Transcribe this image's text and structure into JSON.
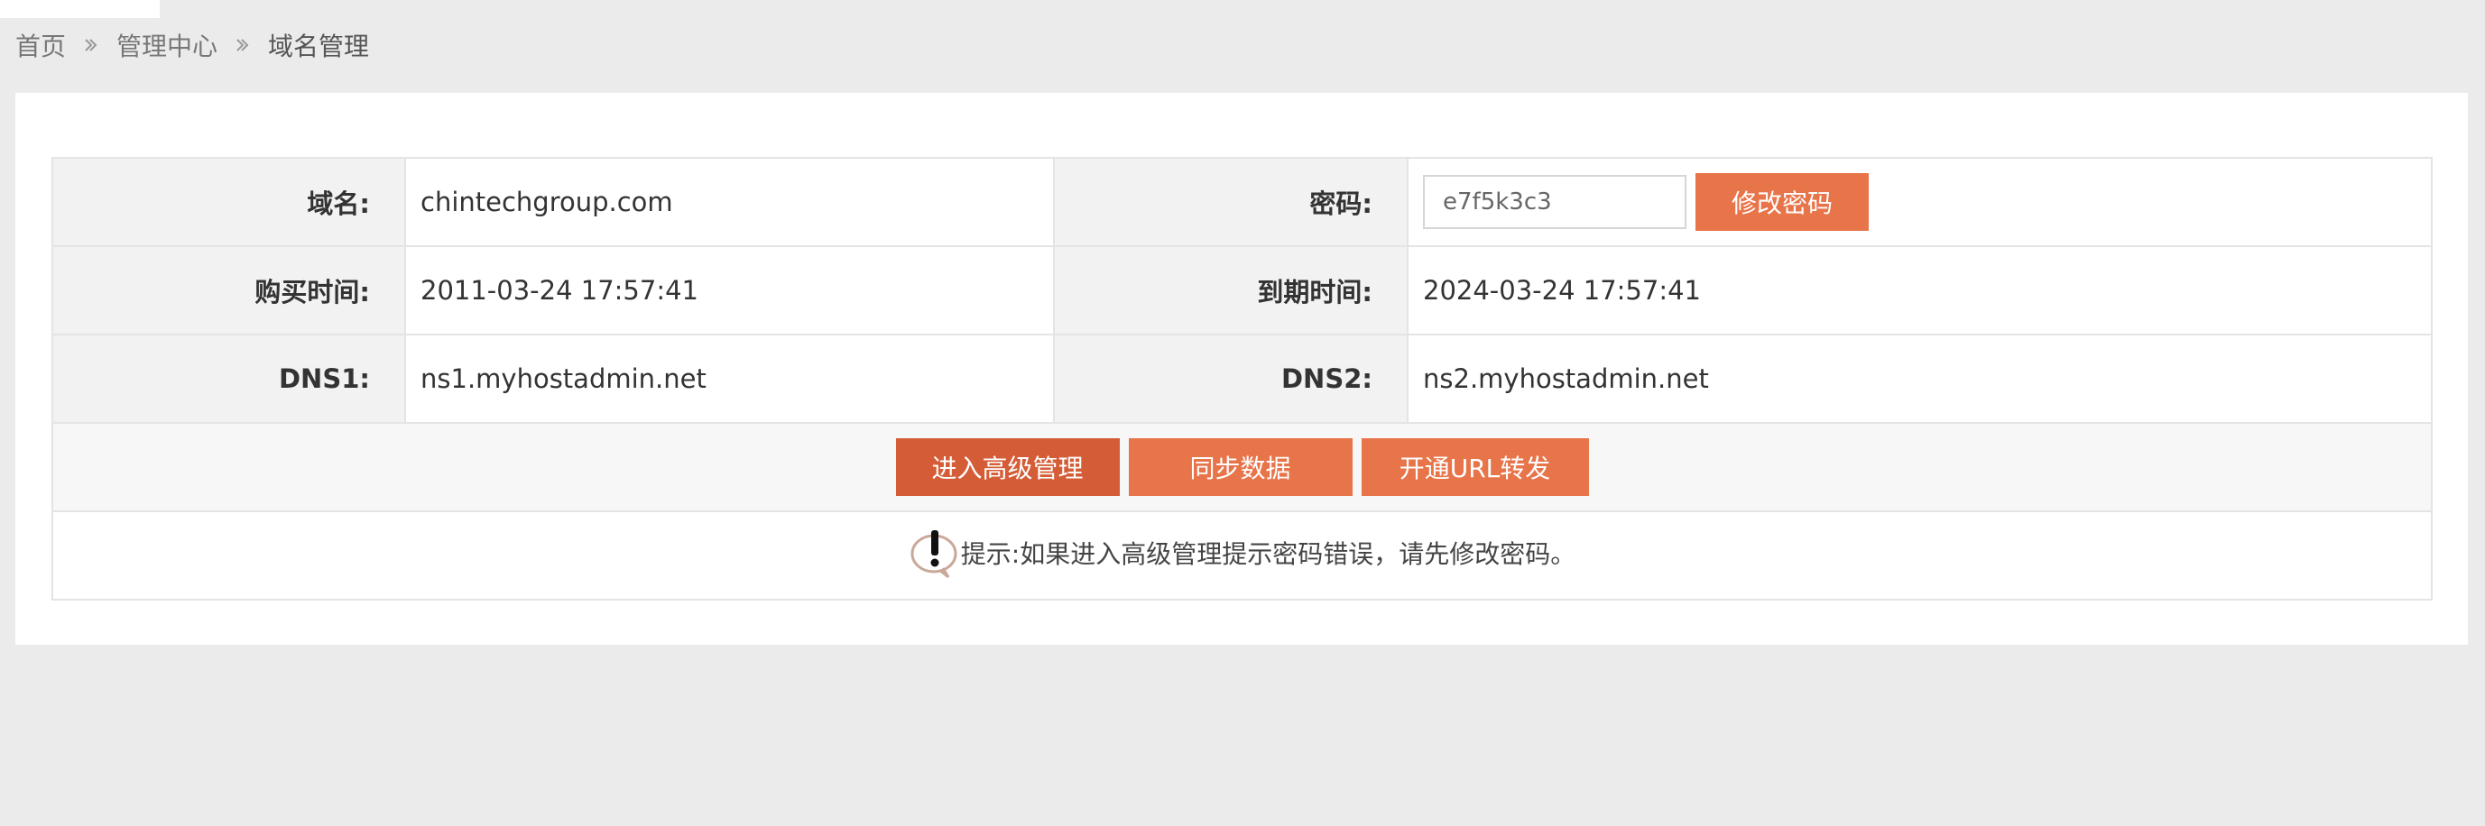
{
  "breadcrumb": {
    "home": "首页",
    "manage_center": "管理中心",
    "current": "域名管理"
  },
  "domain_info": {
    "domain_label": "域名:",
    "domain_value": "chintechgroup.com",
    "password_label": "密码:",
    "password_value": "e7f5k3c3",
    "change_password_button": "修改密码",
    "purchase_time_label": "购买时间:",
    "purchase_time_value": "2011-03-24 17:57:41",
    "expire_time_label": "到期时间:",
    "expire_time_value": "2024-03-24 17:57:41",
    "dns1_label": "DNS1:",
    "dns1_value": "ns1.myhostadmin.net",
    "dns2_label": "DNS2:",
    "dns2_value": "ns2.myhostadmin.net"
  },
  "actions": {
    "advanced_manage": "进入高级管理",
    "sync_data": "同步数据",
    "url_forward": "开通URL转发"
  },
  "tip": {
    "text": "提示:如果进入高级管理提示密码错误，请先修改密码。"
  },
  "colors": {
    "accent": "#e8744a",
    "accent_dark": "#d45c36",
    "page_background": "#ebebeb"
  }
}
